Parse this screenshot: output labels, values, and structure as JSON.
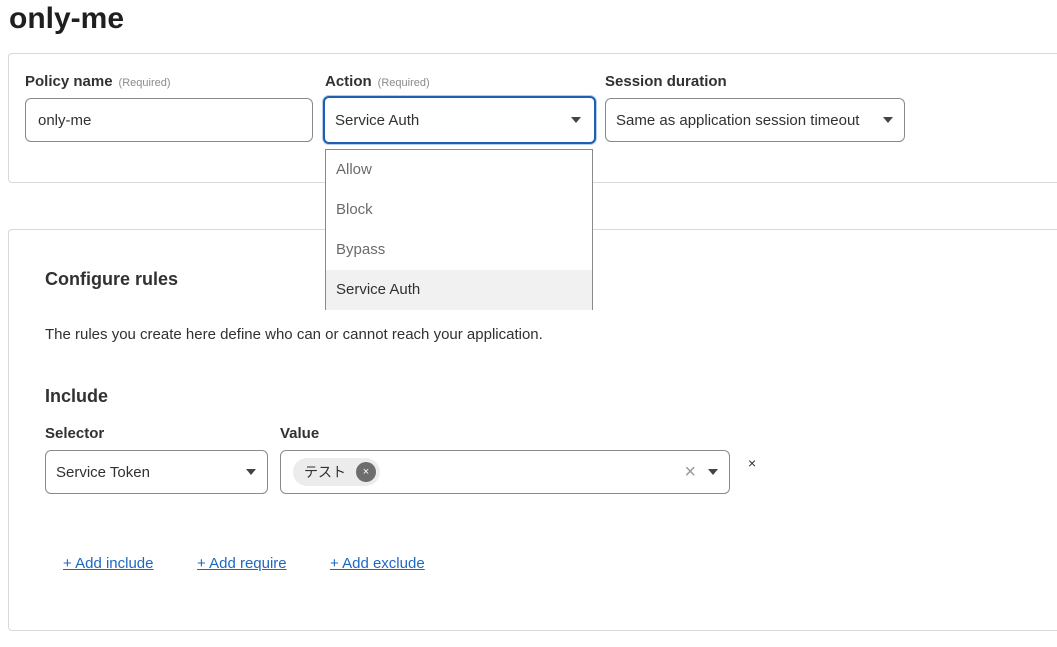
{
  "page": {
    "title": "only-me"
  },
  "policy": {
    "name_label": "Policy name",
    "name_required": "(Required)",
    "name_value": "only-me",
    "action_label": "Action",
    "action_required": "(Required)",
    "action_value": "Service Auth",
    "action_options": [
      "Allow",
      "Block",
      "Bypass",
      "Service Auth"
    ],
    "session_label": "Session duration",
    "session_value": "Same as application session timeout"
  },
  "rules": {
    "title": "Configure rules",
    "description": "The rules you create here define who can or cannot reach your application.",
    "include_title": "Include",
    "selector_label": "Selector",
    "selector_value": "Service Token",
    "value_label": "Value",
    "value_tag": "テスト",
    "remove_row_glyph": "×",
    "clear_glyph": "×",
    "tag_remove_glyph": "×",
    "links": {
      "add_include": "+ Add include",
      "add_require": "+ Add require",
      "add_exclude": "+ Add exclude"
    }
  },
  "colors": {
    "accent": "#1d5fb0",
    "link": "#1d67c4",
    "border": "#8a8a8a"
  }
}
